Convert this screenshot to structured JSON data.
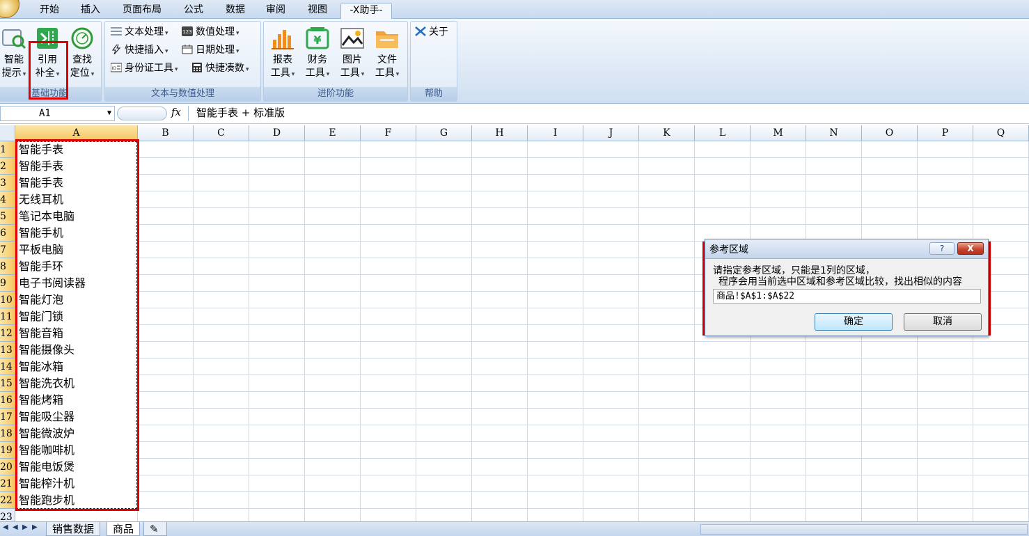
{
  "ribbon_tabs": [
    "开始",
    "插入",
    "页面布局",
    "公式",
    "数据",
    "审阅",
    "视图",
    "-X助手-"
  ],
  "active_tab_index": 7,
  "ribbon": {
    "groups": [
      {
        "label": "基础功能",
        "buttons": [
          {
            "line1": "智能",
            "line2": "提示",
            "icon": "smart-hint-icon"
          },
          {
            "line1": "引用",
            "line2": "补全",
            "icon": "reference-complete-icon"
          },
          {
            "line1": "查找",
            "line2": "定位",
            "icon": "find-locate-icon"
          }
        ]
      },
      {
        "label": "文本与数值处理",
        "buttons": [
          {
            "label": "文本处理",
            "icon": "text-lines-icon"
          },
          {
            "label": "数值处理",
            "icon": "number-123-icon"
          },
          {
            "label": "快捷插入",
            "icon": "lightning-icon"
          },
          {
            "label": "日期处理",
            "icon": "calendar-icon"
          },
          {
            "label": "身份证工具",
            "icon": "id-card-icon"
          },
          {
            "label": "快捷凑数",
            "icon": "calculator-icon"
          }
        ]
      },
      {
        "label": "进阶功能",
        "buttons": [
          {
            "line1": "报表",
            "line2": "工具",
            "icon": "report-chart-icon"
          },
          {
            "line1": "财务",
            "line2": "工具",
            "icon": "finance-yen-icon"
          },
          {
            "line1": "图片",
            "line2": "工具",
            "icon": "picture-icon"
          },
          {
            "line1": "文件",
            "line2": "工具",
            "icon": "folder-icon"
          }
        ]
      },
      {
        "label": "帮助",
        "buttons": [
          {
            "label": "关于",
            "icon": "x-logo-icon"
          }
        ]
      }
    ]
  },
  "formula_bar": {
    "name_box": "A1",
    "fx": "fx",
    "content": "智能手表 + 标准版"
  },
  "columns": [
    "A",
    "B",
    "C",
    "D",
    "E",
    "F",
    "G",
    "H",
    "I",
    "J",
    "K",
    "L",
    "M",
    "N",
    "O",
    "P",
    "Q"
  ],
  "rows": [
    "1",
    "2",
    "3",
    "4",
    "5",
    "6",
    "7",
    "8",
    "9",
    "10",
    "11",
    "12",
    "13",
    "14",
    "15",
    "16",
    "17",
    "18",
    "19",
    "20",
    "21",
    "22",
    "23"
  ],
  "column_a_values": [
    "智能手表",
    "智能手表",
    "智能手表",
    "无线耳机",
    "笔记本电脑",
    "智能手机",
    "平板电脑",
    "智能手环",
    "电子书阅读器",
    "智能灯泡",
    "智能门锁",
    "智能音箱",
    "智能摄像头",
    "智能冰箱",
    "智能洗衣机",
    "智能烤箱",
    "智能吸尘器",
    "智能微波炉",
    "智能咖啡机",
    "智能电饭煲",
    "智能榨汁机",
    "智能跑步机"
  ],
  "sheet_tabs": [
    "销售数据",
    "商品"
  ],
  "active_sheet_index": 1,
  "dialog": {
    "title": "参考区域",
    "help": "?",
    "close": "X",
    "message_line1": "请指定参考区域，只能是1列的区域，",
    "message_line2": "程序会用当前选中区域和参考区域比较，找出相似的内容",
    "input_value": "商品!$A$1:$A$22",
    "ok_label": "确定",
    "cancel_label": "取消"
  },
  "colors": {
    "highlight_red": "#e00000",
    "ribbon_blue": "#dbe7f5",
    "selected_header": "#f6c660"
  }
}
